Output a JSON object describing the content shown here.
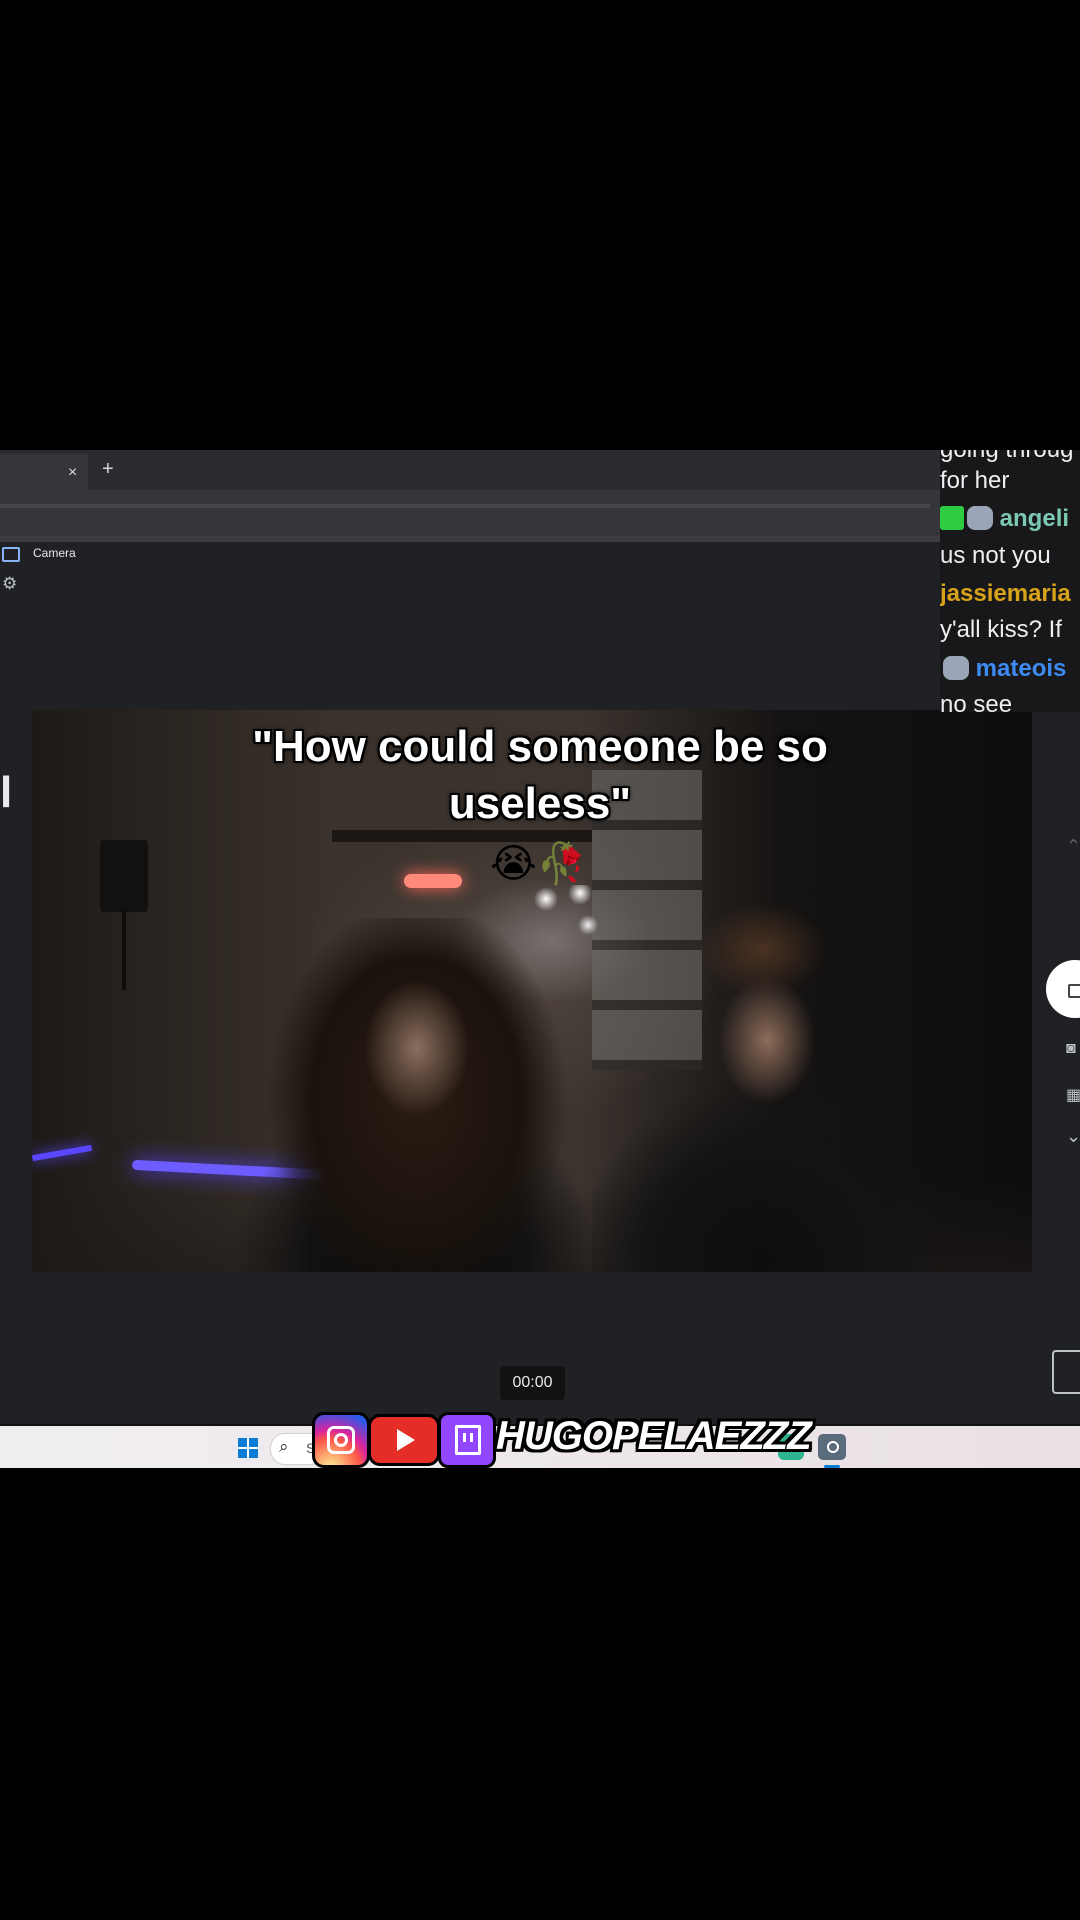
{
  "browser": {
    "tab_close": "×",
    "tab_new": "+"
  },
  "camera_app": {
    "title": "Camera",
    "timer": "00:00",
    "left_glyph": "l"
  },
  "caption": {
    "text": "\"How could someone be so useless\"",
    "emoji": "😭🥀"
  },
  "chat": {
    "messages": [
      {
        "user": "",
        "text": "going throug"
      },
      {
        "user": "",
        "text": "for her"
      },
      {
        "user": "angeli",
        "text": "us not you"
      },
      {
        "user": "jassiemaria",
        "text": "y'all kiss? If"
      },
      {
        "user": "mateois",
        "text": "no see"
      }
    ]
  },
  "taskbar": {
    "search_text": "S"
  },
  "social_banner": {
    "handle": "HUGOPELAEZZZ",
    "platforms": [
      "instagram-icon",
      "youtube-icon",
      "twitch-icon"
    ]
  },
  "colors": {
    "instagram": "#d6249f",
    "youtube": "#e52d27",
    "twitch": "#9146ff",
    "chat_user_green": "#7cc9b2",
    "chat_user_gold": "#d8a31a",
    "chat_user_blue": "#3d8bf2"
  }
}
